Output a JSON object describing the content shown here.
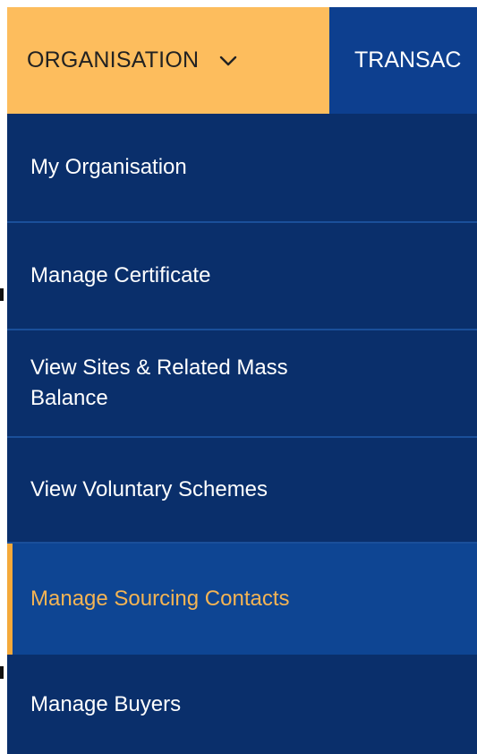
{
  "nav": {
    "active_label": "ORGANISATION",
    "next_label": "TRANSAC"
  },
  "menu": {
    "items": [
      {
        "label": "My Organisation"
      },
      {
        "label": "Manage Certificate"
      },
      {
        "label": "View Sites & Related Mass Balance"
      },
      {
        "label": "View Voluntary Schemes"
      },
      {
        "label": "Manage Sourcing Contacts"
      },
      {
        "label": "Manage Buyers"
      }
    ],
    "active_index": 4
  },
  "colors": {
    "nav_background": "#0d3f8f",
    "active_nav_background": "#fdbd5d",
    "menu_background": "#0a2f6b",
    "active_item_background": "#0e4593",
    "active_item_text": "#f4b454",
    "accent": "#f4a93a"
  },
  "icons": {
    "dropdown": "chevron-down-icon"
  }
}
